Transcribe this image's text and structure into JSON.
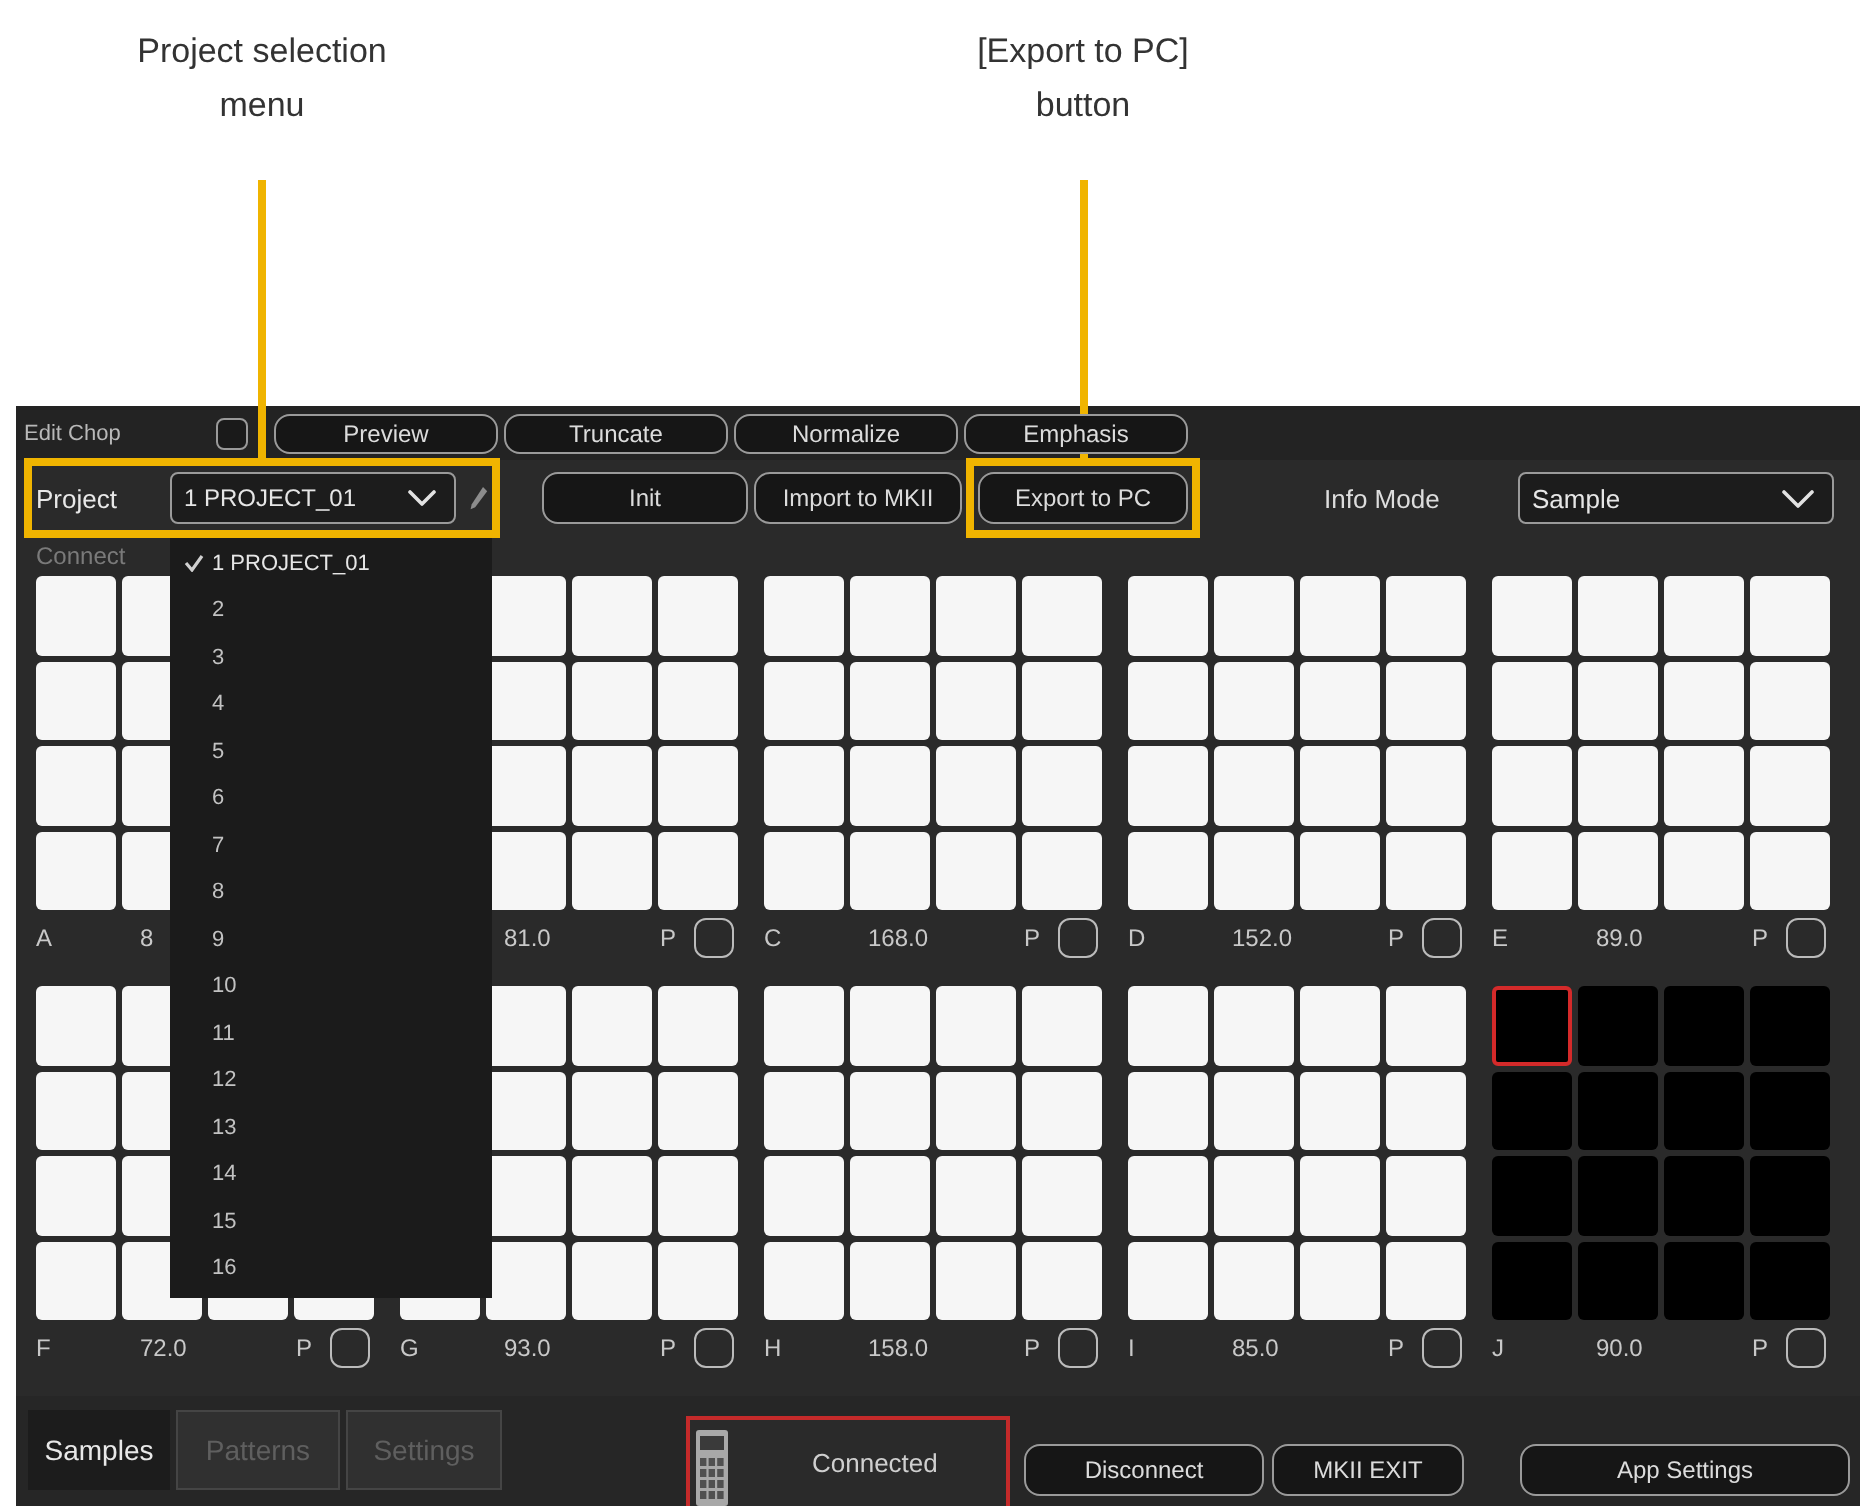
{
  "callouts": [
    {
      "text": "Project selection\nmenu"
    },
    {
      "text": "[Export to PC]\nbutton"
    }
  ],
  "edit_bar": {
    "label": "Edit Chop",
    "checked": false,
    "buttons": [
      "Preview",
      "Truncate",
      "Normalize",
      "Emphasis"
    ]
  },
  "project_bar": {
    "label": "Project",
    "value": "1 PROJECT_01",
    "highlighted": true,
    "buttons": [
      {
        "label": "Init",
        "highlighted": false
      },
      {
        "label": "Import to MKII",
        "highlighted": false
      },
      {
        "label": "Export to PC",
        "highlighted": true
      }
    ],
    "info_mode": {
      "label": "Info Mode",
      "value": "Sample"
    }
  },
  "status_text": "Connect",
  "project_menu": {
    "items": [
      {
        "label": "1 PROJECT_01",
        "selected": true
      },
      {
        "label": "2",
        "selected": false
      },
      {
        "label": "3",
        "selected": false
      },
      {
        "label": "4",
        "selected": false
      },
      {
        "label": "5",
        "selected": false
      },
      {
        "label": "6",
        "selected": false
      },
      {
        "label": "7",
        "selected": false
      },
      {
        "label": "8",
        "selected": false
      },
      {
        "label": "9",
        "selected": false
      },
      {
        "label": "10",
        "selected": false
      },
      {
        "label": "11",
        "selected": false
      },
      {
        "label": "12",
        "selected": false
      },
      {
        "label": "13",
        "selected": false
      },
      {
        "label": "14",
        "selected": false
      },
      {
        "label": "15",
        "selected": false
      },
      {
        "label": "16",
        "selected": false
      }
    ]
  },
  "banks": [
    {
      "letter": "A",
      "value": "8",
      "selected": false
    },
    {
      "value": "81.0",
      "flag": "P",
      "checked": false,
      "selected": false
    },
    {
      "letter": "C",
      "value": "168.0",
      "flag": "P",
      "checked": false,
      "selected": false
    },
    {
      "letter": "D",
      "value": "152.0",
      "flag": "P",
      "checked": false,
      "selected": false
    },
    {
      "letter": "E",
      "value": "89.0",
      "flag": "P",
      "checked": false,
      "selected": false
    },
    {
      "letter": "F",
      "value": "72.0",
      "flag": "P",
      "checked": false,
      "selected": false
    },
    {
      "letter": "G",
      "value": "93.0",
      "flag": "P",
      "checked": false,
      "selected": false
    },
    {
      "letter": "H",
      "value": "158.0",
      "flag": "P",
      "checked": false,
      "selected": false
    },
    {
      "letter": "I",
      "value": "85.0",
      "flag": "P",
      "checked": false,
      "selected": false
    },
    {
      "letter": "J",
      "value": "90.0",
      "flag": "P",
      "checked": false,
      "selected": true,
      "pads": [
        {
          "selected": true
        },
        {
          "selected": false
        },
        {
          "selected": false
        },
        {
          "selected": false
        },
        {
          "selected": false
        },
        {
          "selected": false
        },
        {
          "selected": false
        },
        {
          "selected": false
        },
        {
          "selected": false
        },
        {
          "selected": false
        },
        {
          "selected": false
        },
        {
          "selected": false
        },
        {
          "selected": false
        },
        {
          "selected": false
        },
        {
          "selected": false
        },
        {
          "selected": false
        }
      ]
    }
  ],
  "tabs": [
    {
      "label": "Samples",
      "selected": true
    },
    {
      "label": "Patterns",
      "selected": false
    },
    {
      "label": "Settings",
      "selected": false
    }
  ],
  "connection": {
    "status": "Connected"
  },
  "buttons": [
    "Disconnect",
    "MKII EXIT",
    "App Settings"
  ]
}
